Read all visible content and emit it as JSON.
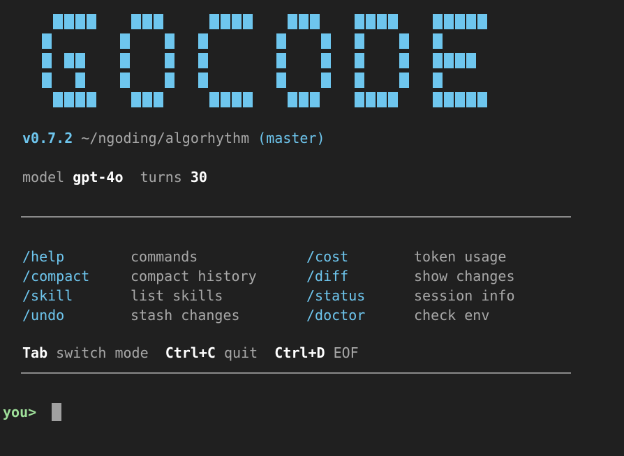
{
  "logo": {
    "text": "GOCODE",
    "color": "#6ec6ee"
  },
  "status": {
    "version": "v0.7.2",
    "path": "~/ngoding/algorhythm",
    "branch": "(master)"
  },
  "model_line": {
    "model_label": "model",
    "model_value": "gpt-4o",
    "turns_label": "turns",
    "turns_value": "30"
  },
  "commands": [
    {
      "cmd": "/help",
      "desc": "commands",
      "cmd2": "/cost",
      "desc2": "token usage"
    },
    {
      "cmd": "/compact",
      "desc": "compact history",
      "cmd2": "/diff",
      "desc2": "show changes"
    },
    {
      "cmd": "/skill",
      "desc": "list skills",
      "cmd2": "/status",
      "desc2": "session info"
    },
    {
      "cmd": "/undo",
      "desc": "stash changes",
      "cmd2": "/doctor",
      "desc2": "check env"
    }
  ],
  "shortcuts": {
    "k1": "Tab",
    "d1": "switch mode",
    "k2": "Ctrl+C",
    "d2": "quit",
    "k3": "Ctrl+D",
    "d3": "EOF"
  },
  "prompt": {
    "label": "you>"
  },
  "colors": {
    "accent": "#6ec6ee",
    "prompt": "#9fe09a",
    "background": "#202020"
  }
}
